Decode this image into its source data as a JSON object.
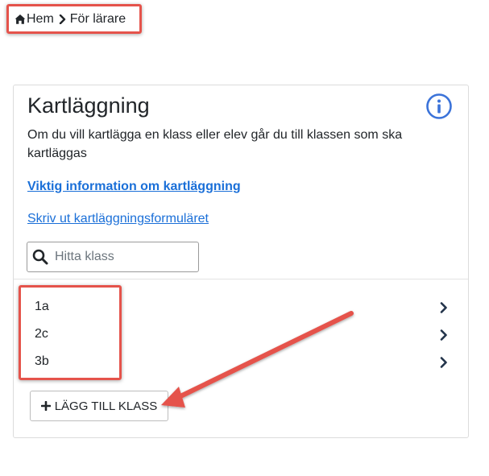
{
  "breadcrumb": {
    "home_label": "Hem",
    "current_label": "För lärare"
  },
  "card": {
    "title": "Kartläggning",
    "description": "Om du vill kartlägga en klass eller elev går du till klassen som ska kartläggas",
    "important_link": "Viktig information om kartläggning",
    "print_link": "Skriv ut kartläggningsformuläret"
  },
  "search": {
    "placeholder": "Hitta klass",
    "value": ""
  },
  "classes": [
    {
      "name": "1a"
    },
    {
      "name": "2c"
    },
    {
      "name": "3b"
    }
  ],
  "add_button": {
    "label": "LÄGG TILL KLASS"
  },
  "icons": {
    "home": "home-icon",
    "breadcrumb_separator": "chevron-right-icon",
    "info": "info-circle-icon",
    "search": "search-icon",
    "row_chevron": "chevron-right-icon",
    "plus": "plus-icon"
  },
  "colors": {
    "link": "#1a6fd8",
    "info_icon": "#3b73d9",
    "annotation_red": "#e5534b",
    "text": "#212529",
    "chevron": "#22334a"
  }
}
